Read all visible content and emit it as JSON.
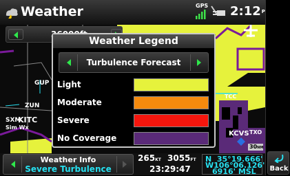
{
  "header": {
    "title": "Weather",
    "gps_label": "GPS",
    "time": "2:12",
    "time_suffix": "PM"
  },
  "map": {
    "altitude": "36000ft",
    "labels": {
      "gup": "GUP",
      "zun": "ZUN",
      "sxm": "SXM",
      "kitc": "KITC",
      "sim_wx": "Sim Wx",
      "tcc": "TCC",
      "kcvs": "KCVS",
      "txo": "TXO",
      "scale": "30",
      "scale_unit": "NM"
    }
  },
  "legend": {
    "title": "Weather Legend",
    "selector": "Turbulence Forecast",
    "items": [
      {
        "label": "Light",
        "color": "#e6f23c"
      },
      {
        "label": "Moderate",
        "color": "#f58a0d"
      },
      {
        "label": "Severe",
        "color": "#f5160d"
      },
      {
        "label": "No Coverage",
        "color": "#5a2a78"
      }
    ]
  },
  "info": {
    "title": "Weather Info",
    "value": "Severe Turbulence",
    "speed": "265",
    "speed_unit": "KT",
    "track": "3055",
    "track_unit": "FT",
    "utc": "23:29:47",
    "lat": "N  35°19.666'",
    "lon": "W106°06.126'",
    "elevation": "6916' MSL"
  },
  "back_label": "Back",
  "colors": {
    "accent_green": "#2ee84b",
    "cyan": "#27e0f0",
    "purple": "#7a1a9a"
  }
}
